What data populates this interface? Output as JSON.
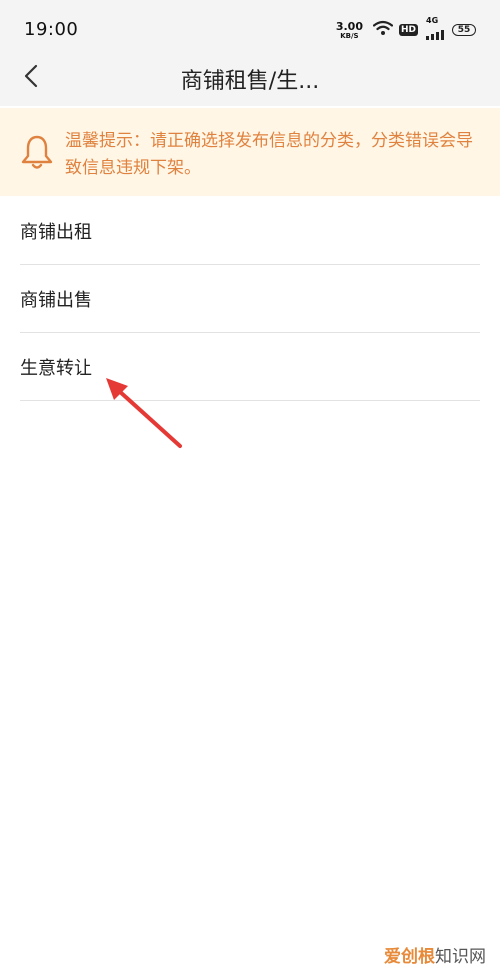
{
  "status_bar": {
    "time": "19:00",
    "net_speed_value": "3.00",
    "net_speed_unit": "KB/S",
    "hd_label": "HD",
    "signal_label": "4G",
    "battery_level": "55"
  },
  "nav": {
    "title": "商铺租售/生..."
  },
  "notice": {
    "text": "温馨提示：请正确选择发布信息的分类，分类错误会导致信息违规下架。"
  },
  "categories": [
    {
      "label": "商铺出租"
    },
    {
      "label": "商铺出售"
    },
    {
      "label": "生意转让"
    }
  ],
  "annotation": {
    "arrow_color": "#e53935"
  },
  "watermark": {
    "brand": "爱创根",
    "suffix": "知识网"
  },
  "colors": {
    "notice_bg": "#fff6e6",
    "notice_text": "#e0823f",
    "bar_bg": "#f4f4f4",
    "divider": "#e2e2e2"
  }
}
